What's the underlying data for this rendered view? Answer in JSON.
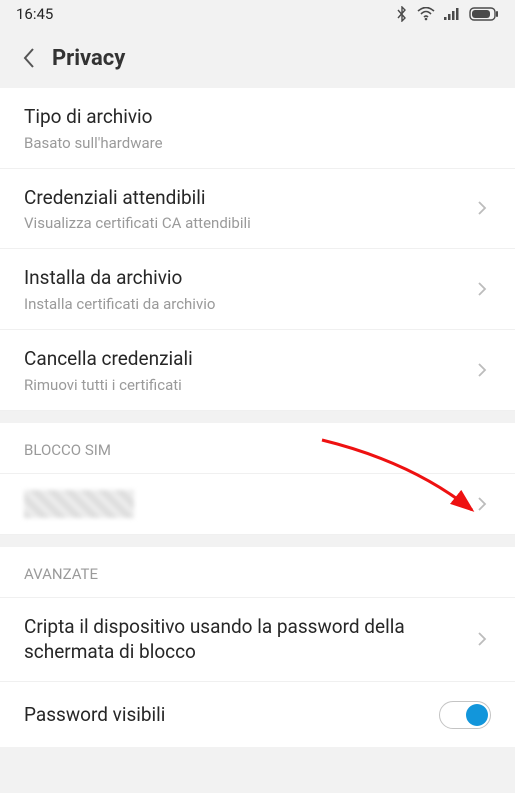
{
  "statusbar": {
    "time": "16:45"
  },
  "header": {
    "title": "Privacy"
  },
  "rows": {
    "archive_type": {
      "title": "Tipo di archivio",
      "sub": "Basato sull'hardware"
    },
    "trusted_creds": {
      "title": "Credenziali attendibili",
      "sub": "Visualizza certificati CA attendibili"
    },
    "install_archive": {
      "title": "Installa da archivio",
      "sub": "Installa certificati da archivio"
    },
    "clear_creds": {
      "title": "Cancella credenziali",
      "sub": "Rimuovi tutti i certificati"
    },
    "encrypt": {
      "title": "Cripta il dispositivo usando la password della schermata di blocco"
    },
    "pwd_visible": {
      "title": "Password visibili"
    }
  },
  "sections": {
    "sim_lock": "BLOCCO SIM",
    "advanced": "AVANZATE"
  }
}
